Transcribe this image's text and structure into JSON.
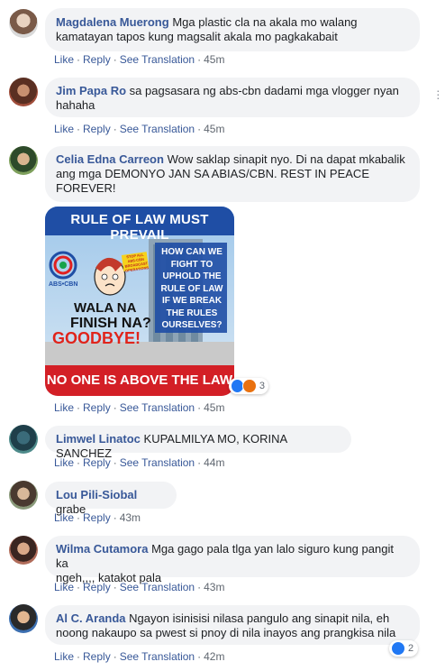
{
  "comments": [
    {
      "name": "Magdalena Muerong",
      "text_line1": "Mga plastic cla na akala mo walang",
      "text_line2": "kamatayan tapos kung magsalit akala mo pagkakabait",
      "like": "Like",
      "reply": "Reply",
      "see_translation": "See Translation",
      "time": "45m"
    },
    {
      "name": "Jim Papa Ro",
      "text_line1": "sa pagsasara ng abs-cbn dadami mga vlogger nyan",
      "text_line2": "hahaha",
      "like": "Like",
      "reply": "Reply",
      "see_translation": "See Translation",
      "time": "45m"
    },
    {
      "name": "Celia Edna Carreon",
      "text_line1": "Wow saklap sinapit nyo. Di na dapat mkabalik",
      "text_line2": "ang mga DEMONYO JAN SA ABIAS/CBN. REST IN PEACE",
      "text_line3": "FOREVER!",
      "reaction_count": "3",
      "like": "Like",
      "reply": "Reply",
      "see_translation": "See Translation",
      "time": "45m"
    },
    {
      "name": "Limwel Linatoc",
      "text_line1": "KUPALMILYA MO, KORINA SANCHEZ",
      "like": "Like",
      "reply": "Reply",
      "see_translation": "See Translation",
      "time": "44m"
    },
    {
      "name": "Lou Pili-Siobal",
      "text_line1": "grabe",
      "like": "Like",
      "reply": "Reply",
      "time": "43m"
    },
    {
      "name": "Wilma Cutamora",
      "text_line1": "Mga gago pala tlga yan lalo siguro kung pangit ka",
      "text_line2": "ngeh,,,, katakot pala",
      "like": "Like",
      "reply": "Reply",
      "see_translation": "See Translation",
      "time": "43m"
    },
    {
      "name": "Al C. Aranda",
      "text_line1": "Ngayon isinisisi nilasa pangulo ang sinapit nila, eh",
      "text_line2": "noong nakaupo sa pwest si pnoy di nila inayos ang prangkisa nila",
      "reaction_count": "2",
      "like": "Like",
      "reply": "Reply",
      "see_translation": "See Translation",
      "time": "42m"
    }
  ],
  "meme": {
    "top_banner": "RULE OF LAW MUST PREVAIL",
    "logo_text": "ABS•CBN",
    "sticker": "STOP ALL ABS-CBN BROADCAST OPERATIONS",
    "left_line1": "WALA NA",
    "left_line2": "FINISH NA?",
    "left_line3": "GOODBYE!",
    "right_text_lines": [
      "HOW CAN WE",
      "FIGHT TO",
      "UPHOLD THE",
      "RULE OF LAW",
      "IF WE BREAK",
      "THE RULES",
      "OURSELVES?"
    ],
    "bottom_banner": "NO ONE IS ABOVE THE LAW"
  },
  "icons": {
    "more": "more-horizontal-icon",
    "like_reaction": "like-reaction-icon",
    "angry_reaction": "angry-reaction-icon"
  }
}
